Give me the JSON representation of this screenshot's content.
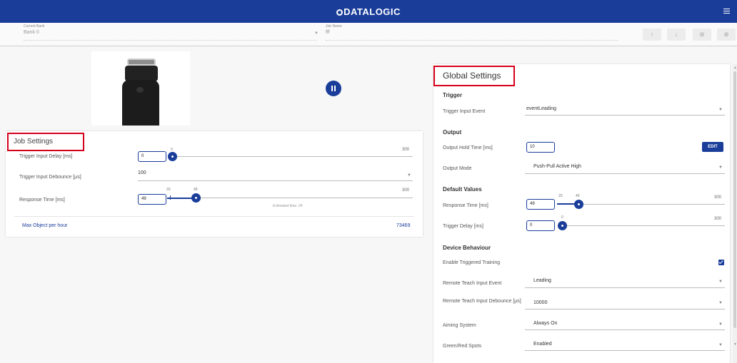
{
  "header": {
    "brand": "DATALOGIC"
  },
  "bank": {
    "label": "Current Bank",
    "value": "Bank 0"
  },
  "job": {
    "label": "Job Name",
    "value": "fff"
  },
  "toolbar": {
    "up_icon": "↑",
    "down_icon": "↓",
    "add_icon": "⊕",
    "remove_icon": "⊗"
  },
  "job_settings": {
    "title": "Job Settings",
    "trigger_delay": {
      "label": "Trigger Input Delay [ms]",
      "value": "0",
      "min": "0",
      "max": "300",
      "current": "0"
    },
    "trigger_debounce": {
      "label": "Trigger Input Debounce [µs]",
      "value": "100"
    },
    "response_time": {
      "label": "Response Time [ms]",
      "value": "49",
      "min": "20",
      "max": "300",
      "current": "49",
      "estimate": "Estimated time: 24"
    },
    "max_object": {
      "label": "Max Object per hour",
      "value": "73469"
    }
  },
  "global_settings": {
    "title": "Global Settings",
    "trigger": {
      "section": "Trigger",
      "input_event": {
        "label": "Trigger Input Event",
        "value": "eventLeading"
      }
    },
    "output": {
      "section": "Output",
      "hold_time": {
        "label": "Output Hold Time [ms]",
        "value": "10",
        "edit_label": "EDIT"
      },
      "mode": {
        "label": "Output Mode",
        "value": "Push-Pull Active High"
      }
    },
    "defaults": {
      "section": "Default Values",
      "response_time": {
        "label": "Response Time [ms]",
        "value": "49",
        "min": "20",
        "max": "300",
        "current": "49"
      },
      "trigger_delay": {
        "label": "Trigger Delay [ms]",
        "value": "0",
        "max": "300",
        "current": "0"
      }
    },
    "device": {
      "section": "Device Behaviour",
      "triggered_training": {
        "label": "Enable Triggered Training",
        "checked": true
      },
      "teach_event": {
        "label": "Remote Teach Input Event",
        "value": "Leading"
      },
      "teach_debounce": {
        "label": "Remote Teach Input Debounce [µs]",
        "value": "10000"
      },
      "aiming": {
        "label": "Aiming System",
        "value": "Always On"
      },
      "spots": {
        "label": "Green/Red Spots",
        "value": "Enabled"
      }
    }
  },
  "colors": {
    "primary": "#1a3d9a",
    "highlight": "#d6001c"
  }
}
